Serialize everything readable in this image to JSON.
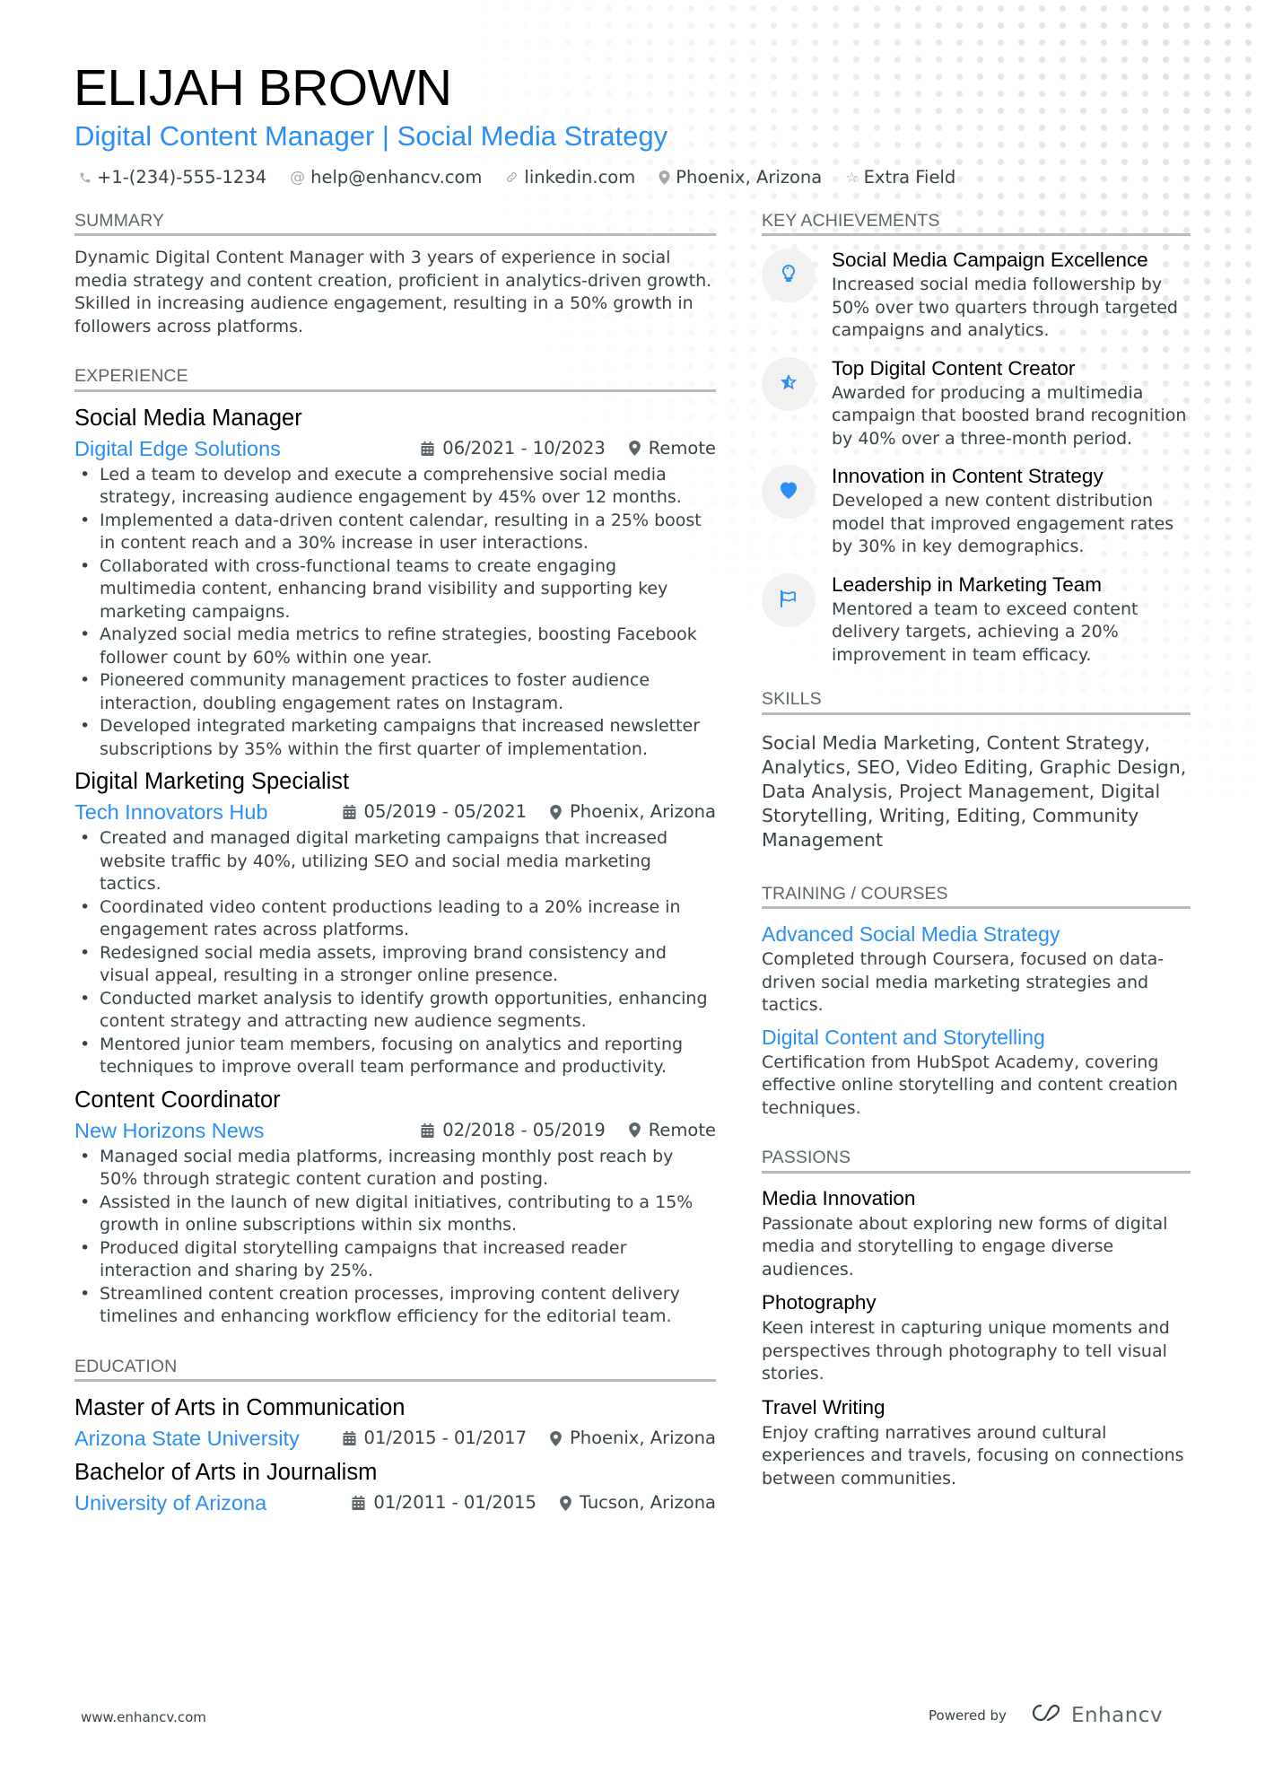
{
  "header": {
    "name": "ELIJAH BROWN",
    "title": "Digital Content Manager | Social Media Strategy",
    "contacts": [
      {
        "icon": "phone-icon",
        "text": "+1-(234)-555-1234"
      },
      {
        "icon": "at-icon",
        "text": "help@enhancv.com"
      },
      {
        "icon": "link-icon",
        "text": "linkedin.com"
      },
      {
        "icon": "location-pin-icon",
        "text": "Phoenix, Arizona"
      },
      {
        "icon": "star-outline-icon",
        "text": "Extra Field"
      }
    ]
  },
  "summary": {
    "heading": "SUMMARY",
    "text": "Dynamic Digital Content Manager with 3 years of experience in social media strategy and content creation, proficient in analytics-driven growth. Skilled in increasing audience engagement, resulting in a 50% growth in followers across platforms."
  },
  "experience": {
    "heading": "EXPERIENCE",
    "jobs": [
      {
        "title": "Social Media Manager",
        "company": "Digital Edge Solutions",
        "dates": "06/2021 - 10/2023",
        "location": "Remote",
        "bullets": [
          "Led a team to develop and execute a comprehensive social media strategy, increasing audience engagement by 45% over 12 months.",
          "Implemented a data-driven content calendar, resulting in a 25% boost in content reach and a 30% increase in user interactions.",
          "Collaborated with cross-functional teams to create engaging multimedia content, enhancing brand visibility and supporting key marketing campaigns.",
          "Analyzed social media metrics to refine strategies, boosting Facebook follower count by 60% within one year.",
          "Pioneered community management practices to foster audience interaction, doubling engagement rates on Instagram.",
          "Developed integrated marketing campaigns that increased newsletter subscriptions by 35% within the first quarter of implementation."
        ]
      },
      {
        "title": "Digital Marketing Specialist",
        "company": "Tech Innovators Hub",
        "dates": "05/2019 - 05/2021",
        "location": "Phoenix, Arizona",
        "bullets": [
          "Created and managed digital marketing campaigns that increased website traffic by 40%, utilizing SEO and social media marketing tactics.",
          "Coordinated video content productions leading to a 20% increase in engagement rates across platforms.",
          "Redesigned social media assets, improving brand consistency and visual appeal, resulting in a stronger online presence.",
          "Conducted market analysis to identify growth opportunities, enhancing content strategy and attracting new audience segments.",
          "Mentored junior team members, focusing on analytics and reporting techniques to improve overall team performance and productivity."
        ]
      },
      {
        "title": "Content Coordinator",
        "company": "New Horizons News",
        "dates": "02/2018 - 05/2019",
        "location": "Remote",
        "bullets": [
          "Managed social media platforms, increasing monthly post reach by 50% through strategic content curation and posting.",
          "Assisted in the launch of new digital initiatives, contributing to a 15% growth in online subscriptions within six months.",
          "Produced digital storytelling campaigns that increased reader interaction and sharing by 25%.",
          "Streamlined content creation processes, improving content delivery timelines and enhancing workflow efficiency for the editorial team."
        ]
      }
    ]
  },
  "education": {
    "heading": "EDUCATION",
    "items": [
      {
        "degree": "Master of Arts in Communication",
        "school": "Arizona State University",
        "dates": "01/2015 - 01/2017",
        "location": "Phoenix, Arizona"
      },
      {
        "degree": "Bachelor of Arts in Journalism",
        "school": "University of Arizona",
        "dates": "01/2011 - 01/2015",
        "location": "Tucson, Arizona"
      }
    ]
  },
  "achievements": {
    "heading": "KEY ACHIEVEMENTS",
    "items": [
      {
        "icon": "lightbulb-icon",
        "title": "Social Media Campaign Excellence",
        "desc": "Increased social media followership by 50% over two quarters through targeted campaigns and analytics."
      },
      {
        "icon": "star-icon",
        "title": "Top Digital Content Creator",
        "desc": "Awarded for producing a multimedia campaign that boosted brand recognition by 40% over a three-month period."
      },
      {
        "icon": "heart-icon",
        "title": "Innovation in Content Strategy",
        "desc": "Developed a new content distribution model that improved engagement rates by 30% in key demographics."
      },
      {
        "icon": "flag-icon",
        "title": "Leadership in Marketing Team",
        "desc": "Mentored a team to exceed content delivery targets, achieving a 20% improvement in team efficacy."
      }
    ]
  },
  "skills": {
    "heading": "SKILLS",
    "text": "Social Media Marketing, Content Strategy, Analytics, SEO, Video Editing, Graphic Design, Data Analysis, Project Management, Digital Storytelling, Writing, Editing, Community Management"
  },
  "training": {
    "heading": "TRAINING / COURSES",
    "items": [
      {
        "title": "Advanced Social Media Strategy",
        "desc": "Completed through Coursera, focused on data-driven social media marketing strategies and tactics."
      },
      {
        "title": "Digital Content and Storytelling",
        "desc": "Certification from HubSpot Academy, covering effective online storytelling and content creation techniques."
      }
    ]
  },
  "passions": {
    "heading": "PASSIONS",
    "items": [
      {
        "title": "Media Innovation",
        "desc": "Passionate about exploring new forms of digital media and storytelling to engage diverse audiences."
      },
      {
        "title": "Photography",
        "desc": "Keen interest in capturing unique moments and perspectives through photography to tell visual stories."
      },
      {
        "title": "Travel Writing",
        "desc": "Enjoy crafting narratives around cultural experiences and travels, focusing on connections between communities."
      }
    ]
  },
  "footer": {
    "website": "www.enhancv.com",
    "powered_by": "Powered by",
    "brand": "Enhancv"
  },
  "colors": {
    "accent": "#2a8ef2",
    "text": "#384347",
    "heading_gray": "#5d676b",
    "rule": "#b7bbbe",
    "icon_circle": "#f1f1f1"
  }
}
